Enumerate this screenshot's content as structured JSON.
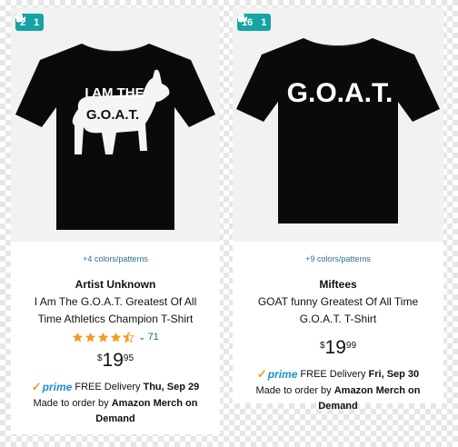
{
  "products": [
    {
      "badge": {
        "images": "2",
        "videos": "1"
      },
      "shirt_text": {
        "line1": "I AM THE",
        "line2": "G.O.A.T."
      },
      "colors_patterns": "+4 colors/patterns",
      "brand": "Artist Unknown",
      "title_line1": "I Am The G.O.A.T. Greatest Of All",
      "title_line2": "Time Athletics Champion T-Shirt",
      "rating": {
        "stars": 4.5,
        "count": "71"
      },
      "price": {
        "symbol": "$",
        "whole": "19",
        "fraction": "95"
      },
      "prime": "prime",
      "delivery_text": "FREE Delivery",
      "delivery_date": "Thu, Sep 29",
      "made_to_order_prefix": "Made to order by",
      "made_to_order_vendor": "Amazon Merch on Demand"
    },
    {
      "badge": {
        "images": "16",
        "videos": "1"
      },
      "shirt_text": {
        "line1": "G.O.A.T."
      },
      "colors_patterns": "+9 colors/patterns",
      "brand": "Miftees",
      "title_line1": "GOAT funny Greatest Of All Time",
      "title_line2": "G.O.A.T. T-Shirt",
      "price": {
        "symbol": "$",
        "whole": "19",
        "fraction": "99"
      },
      "prime": "prime",
      "delivery_text": "FREE Delivery",
      "delivery_date": "Fri, Sep 30",
      "made_to_order_prefix": "Made to order by",
      "made_to_order_vendor": "Amazon Merch on Demand"
    }
  ],
  "colors": {
    "badge": "#17a3a3",
    "star": "#f29c1f",
    "prime": "#1b8fd0",
    "link": "#2f6f8f"
  },
  "icons": {
    "badge_image": "map-pin-icon",
    "badge_video": "camera-icon",
    "rating_dropdown": "chevron-down-icon"
  }
}
